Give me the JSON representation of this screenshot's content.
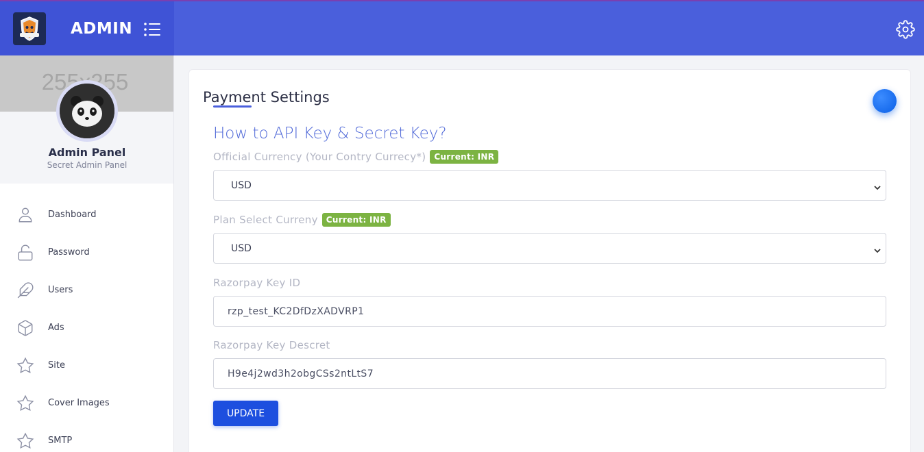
{
  "header": {
    "brand": "ADMIN",
    "logo_icon": "shield-mascot-logo",
    "menu_icon": "list-menu-icon",
    "settings_icon": "gear-icon",
    "bg_color": "#4a5fdc"
  },
  "sidebar": {
    "banner_placeholder": "255x255",
    "profile_name": "Admin Panel",
    "profile_subtitle": "Secret Admin Panel",
    "items": [
      {
        "label": "Dashboard",
        "icon": "user-icon"
      },
      {
        "label": "Password",
        "icon": "unlock-icon"
      },
      {
        "label": "Users",
        "icon": "feather-icon"
      },
      {
        "label": "Ads",
        "icon": "box-icon"
      },
      {
        "label": "Site",
        "icon": "star-icon"
      },
      {
        "label": "Cover Images",
        "icon": "star-icon"
      },
      {
        "label": "SMTP",
        "icon": "star-icon"
      }
    ]
  },
  "main": {
    "title": "Payment Settings",
    "section_heading": "How to API Key & Secret Key?",
    "fields": {
      "official_currency": {
        "label": "Official Currency (Your Contry Currecy*)",
        "badge": "Current: INR",
        "value": "USD"
      },
      "plan_currency": {
        "label": "Plan Select Curreny",
        "badge": "Current: INR",
        "value": "USD"
      },
      "razorpay_key_id": {
        "label": "Razorpay Key ID",
        "value": "rzp_test_KC2DfDzXADVRP1"
      },
      "razorpay_key_secret": {
        "label": "Razorpay Key Descret",
        "value": "H9e4j2wd3h2obgCSs2ntLtS7"
      }
    },
    "submit_label": "UPDATE",
    "accent_color": "#1d4fdf",
    "badge_color": "#7cb342"
  }
}
